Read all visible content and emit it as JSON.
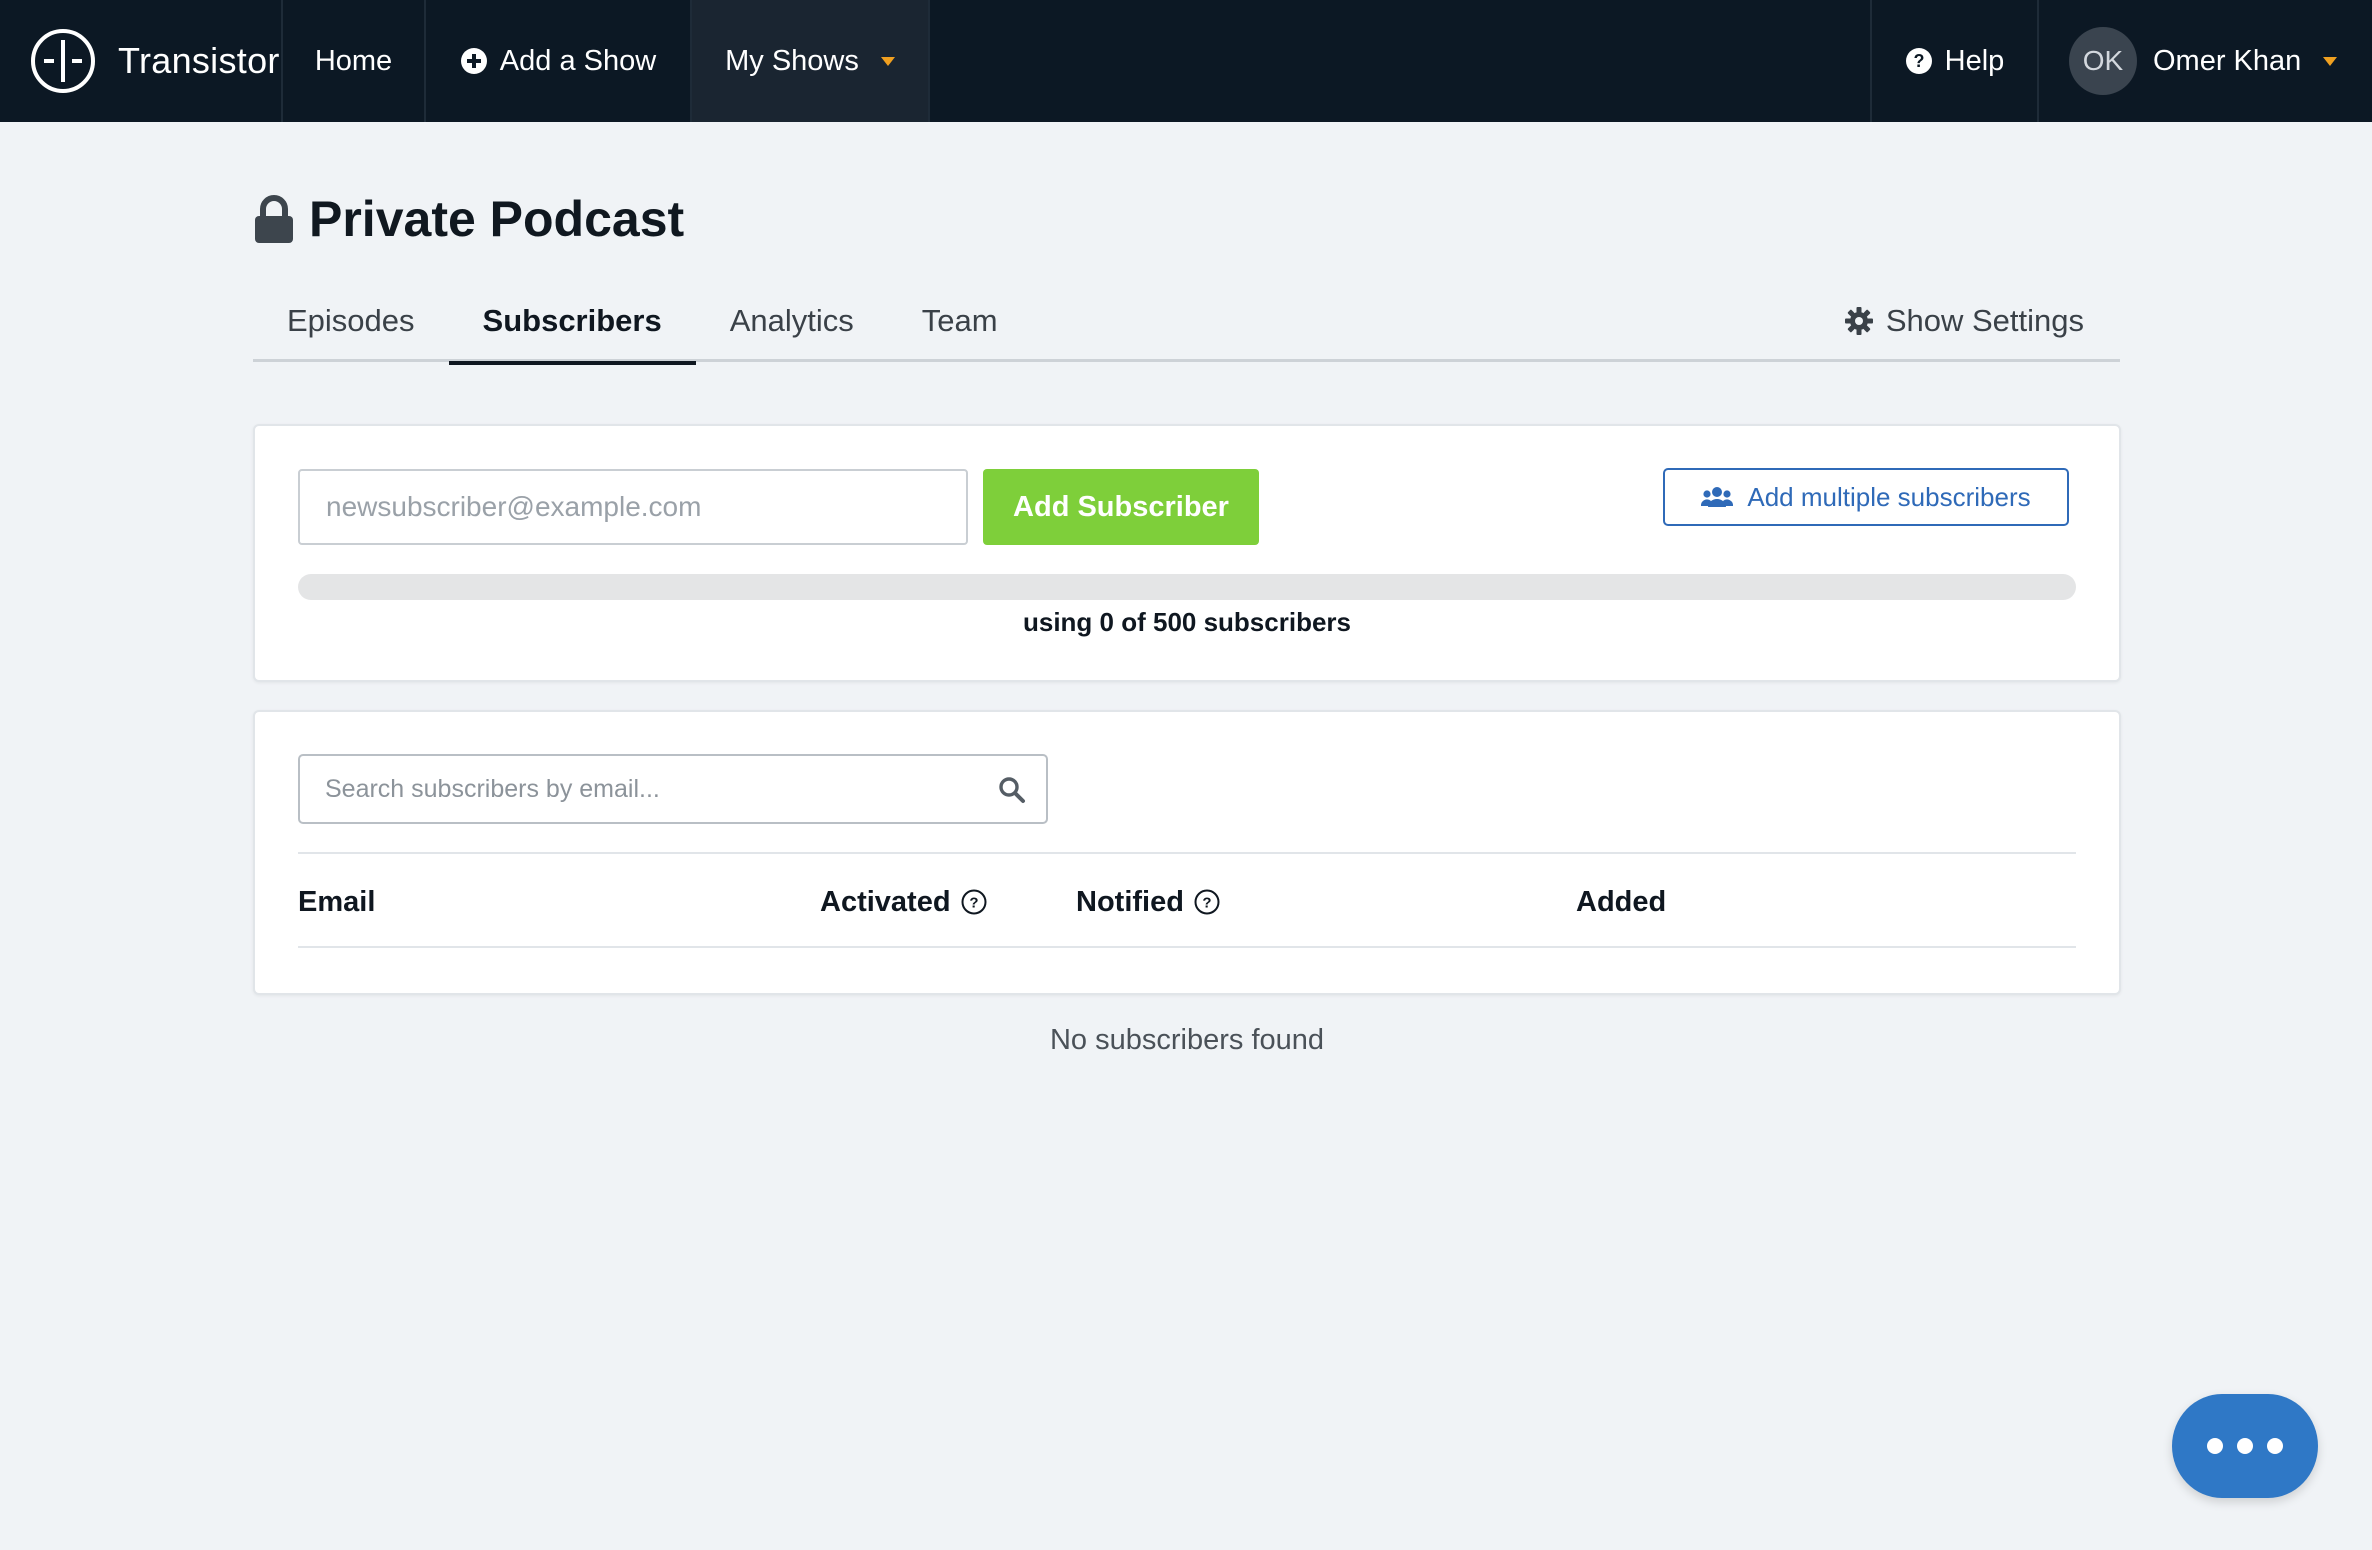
{
  "nav": {
    "brand": "Transistor",
    "home": "Home",
    "add_show": "Add a Show",
    "my_shows": "My Shows",
    "help": "Help",
    "user_initials": "OK",
    "user_name": "Omer Khan"
  },
  "page": {
    "title": "Private Podcast"
  },
  "tabs": {
    "episodes": "Episodes",
    "subscribers": "Subscribers",
    "analytics": "Analytics",
    "team": "Team",
    "settings": "Show Settings",
    "active": "Subscribers"
  },
  "add_form": {
    "email_placeholder": "newsubscriber@example.com",
    "add_button": "Add Subscriber",
    "multi_button": "Add multiple subscribers",
    "usage_text": "using 0 of 500 subscribers",
    "used": 0,
    "limit": 500
  },
  "list": {
    "search_placeholder": "Search subscribers by email...",
    "columns": [
      "Email",
      "Activated",
      "Notified",
      "Added"
    ],
    "empty_text": "No subscribers found"
  },
  "colors": {
    "nav_bg": "#0c1824",
    "accent_green": "#7ecf3a",
    "accent_blue": "#2f6ab8",
    "caret_orange": "#f0a020"
  },
  "icons": {
    "logo": "transistor-logo",
    "add_show": "plus-circle-icon",
    "help": "question-circle-icon",
    "lock": "lock-icon",
    "settings": "gear-icon",
    "multi": "users-icon",
    "search": "search-icon",
    "chat": "chat-bubble-icon"
  }
}
